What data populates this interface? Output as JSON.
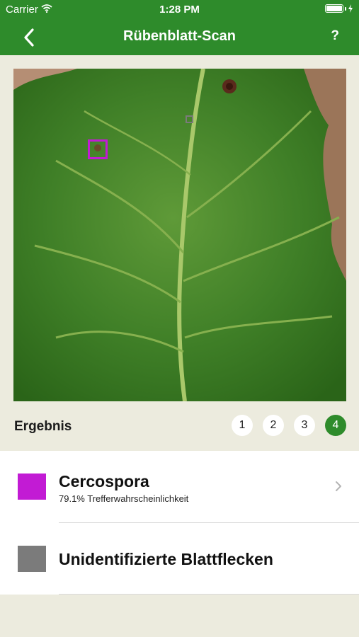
{
  "status_bar": {
    "carrier": "Carrier",
    "time": "1:28 PM"
  },
  "nav": {
    "title": "Rübenblatt-Scan",
    "help_label": "?",
    "back_icon": "chevron-left-icon"
  },
  "colors": {
    "brand_green": "#2e8b2b",
    "cercospora": "#c21bd4",
    "unidentified": "#7b7b7b",
    "background": "#ecebde"
  },
  "result": {
    "label": "Ergebnis",
    "pages": [
      "1",
      "2",
      "3",
      "4"
    ],
    "active_page": "4"
  },
  "detections": [
    {
      "name": "Cercospora",
      "probability": "79.1% Trefferwahrscheinlichkeit",
      "color": "#c21bd4"
    },
    {
      "name": "Unidentifizierte Blattflecken",
      "color": "#7b7b7b"
    }
  ]
}
